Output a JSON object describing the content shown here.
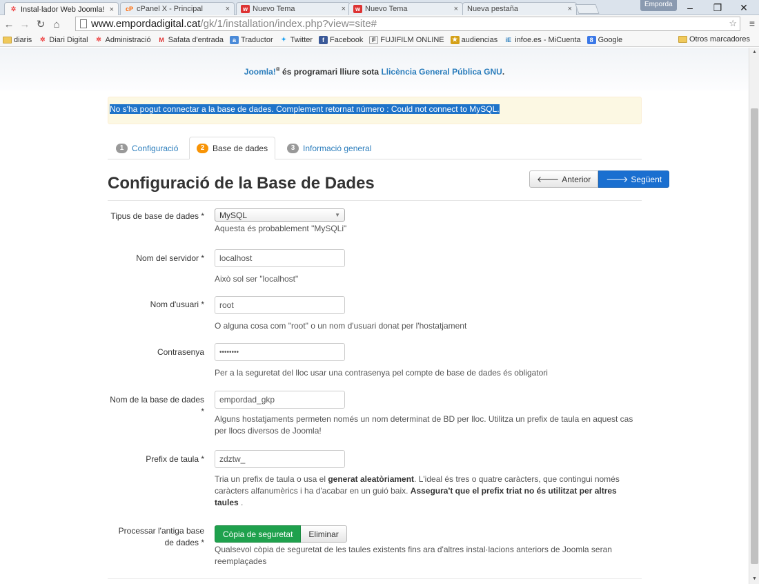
{
  "browser": {
    "tabs": [
      {
        "title": "Instal·lador Web Joomla!",
        "favicon": "joomla-icon",
        "close": "×"
      },
      {
        "title": "cPanel X - Principal",
        "favicon": "cpanel-icon",
        "close": "×"
      },
      {
        "title": "Nuevo Tema",
        "favicon": "wix-icon",
        "close": "×"
      },
      {
        "title": "Nuevo Tema",
        "favicon": "wix-icon",
        "close": "×"
      },
      {
        "title": "Nueva pestaña",
        "favicon": "",
        "close": "×"
      }
    ],
    "user_badge": "Emporda",
    "url_host": "www.empordadigital.cat",
    "url_path": "/gk/1/installation/index.php?view=site#",
    "bookmarks": [
      "diaris",
      "Diari Digital",
      "Administració",
      "Safata d'entrada",
      "Traductor",
      "Twitter",
      "Facebook",
      "FUJIFILM ONLINE",
      "audiencias",
      "infoe.es - MiCuenta",
      "Google"
    ],
    "other_bookmarks": "Otros marcadores"
  },
  "page": {
    "credit": {
      "brand": "Joomla!",
      "mark": "®",
      "middle": " és programari lliure sota ",
      "license": "Llicència General Pública GNU",
      "end": "."
    },
    "alert": "No s'ha pogut connectar a la base de dades. Complement retornat número : Could not connect to MySQL.",
    "steps": [
      {
        "num": "1",
        "label": "Configuració"
      },
      {
        "num": "2",
        "label": "Base de dades"
      },
      {
        "num": "3",
        "label": "Informació general"
      }
    ],
    "heading": "Configuració de la Base de Dades",
    "prev_label": "Anterior",
    "next_label": "Següent",
    "fields": {
      "db_type": {
        "label": "Tipus de base de dades *",
        "value": "MySQL",
        "help": "Aquesta és probablement \"MySQLi\""
      },
      "host": {
        "label": "Nom del servidor *",
        "value": "localhost",
        "help": "Això sol ser \"localhost\""
      },
      "user": {
        "label": "Nom d'usuari *",
        "value": "root",
        "help": "O alguna cosa com \"root\" o un nom d'usuari donat per l'hostatjament"
      },
      "password": {
        "label": "Contrasenya",
        "value": "••••••••",
        "help": "Per a la seguretat del lloc usar una contrasenya pel compte de base de dades és obligatori"
      },
      "db_name": {
        "label": "Nom de la base de dades *",
        "value": "empordad_gkp",
        "help": "Alguns hostatjaments permeten només un nom determinat de BD per lloc. Utilitza un prefix de taula en aquest cas per llocs diversos de Joomla!"
      },
      "prefix": {
        "label": "Prefix de taula *",
        "value": "zdztw_",
        "help_1": "Tria un prefix de taula o usa el ",
        "help_bold_1": "generat aleatòriament",
        "help_2": ". L'ideal és tres o quatre caràcters, que contingui només caràcters alfanumèrics i ha d'acabar en un guió baix. ",
        "help_bold_2": "Assegura't que el prefix triat no és utilitzat per altres taules",
        "help_3": " ."
      },
      "old_db": {
        "label": "Processar l'antiga base de dades *",
        "option_on": "Còpia de seguretat",
        "option_off": "Eliminar",
        "help": "Qualsevol còpia de seguretat de les taules existents fins ara d'altres instal·lacions anteriors de Joomla seran reemplaçades"
      }
    }
  },
  "colors": {
    "link": "#2b7dbc",
    "primary": "#1a6fd0",
    "success": "#1fa14d",
    "alert_bg": "#fcf8e3",
    "step_active_badge": "#f89406"
  }
}
